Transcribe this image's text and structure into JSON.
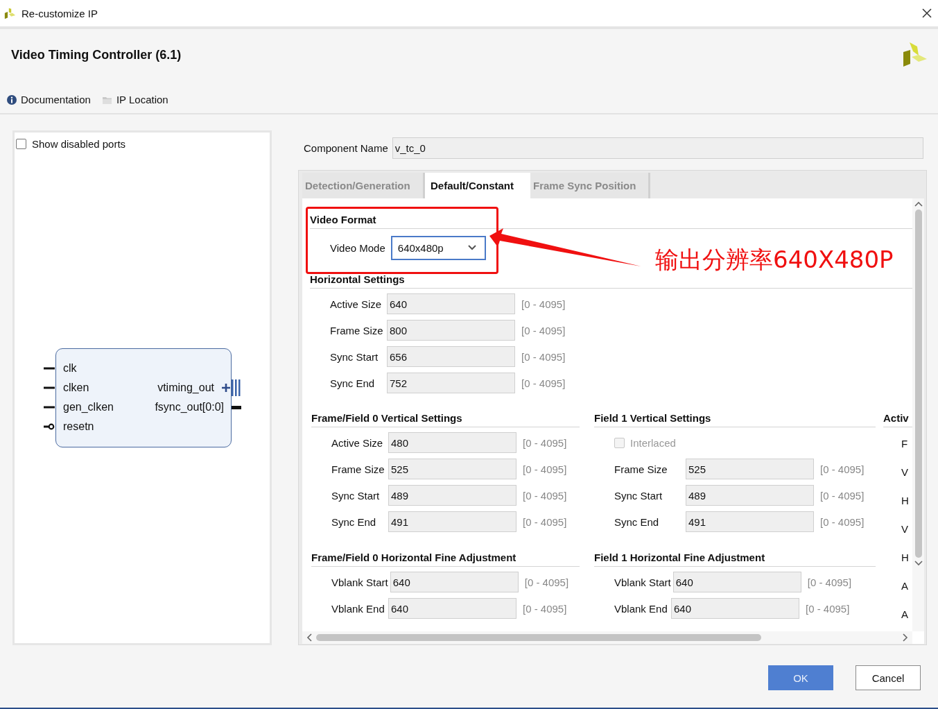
{
  "window": {
    "title": "Re-customize IP"
  },
  "header": {
    "title": "Video Timing Controller (6.1)",
    "links": [
      {
        "kind": "info",
        "label": "Documentation"
      },
      {
        "kind": "folder",
        "label": "IP Location"
      }
    ]
  },
  "symbol_panel": {
    "show_disabled_ports": {
      "label": "Show disabled ports",
      "checked": false
    },
    "inputs": [
      {
        "kind": "plain",
        "name": "clk"
      },
      {
        "kind": "plain",
        "name": "clken"
      },
      {
        "kind": "plain",
        "name": "gen_clken"
      },
      {
        "kind": "inverted",
        "name": "resetn"
      }
    ],
    "outputs": [
      {
        "kind": "interface",
        "name": "vtiming_out"
      },
      {
        "kind": "bus",
        "name": "fsync_out[0:0]"
      }
    ]
  },
  "component_name": {
    "label": "Component Name",
    "value": "v_tc_0"
  },
  "tabs": [
    {
      "label": "Detection/Generation",
      "selected": false
    },
    {
      "label": "Default/Constant",
      "selected": true
    },
    {
      "label": "Frame Sync Position",
      "selected": false
    }
  ],
  "video_format": {
    "title": "Video Format",
    "label": "Video Mode",
    "value": "640x480p"
  },
  "horizontal_settings": {
    "title": "Horizontal Settings",
    "rows": [
      {
        "kind": "field",
        "label": "Active Size",
        "value": "640",
        "range": "[0 - 4095]"
      },
      {
        "kind": "field",
        "label": "Frame Size",
        "value": "800",
        "range": "[0 - 4095]"
      },
      {
        "kind": "field",
        "label": "Sync Start",
        "value": "656",
        "range": "[0 - 4095]"
      },
      {
        "kind": "field",
        "label": "Sync End",
        "value": "752",
        "range": "[0 - 4095]"
      }
    ]
  },
  "columns": [
    {
      "sections": [
        {
          "title": "Frame/Field 0 Vertical Settings",
          "rows": [
            {
              "kind": "field",
              "label": "Active Size",
              "value": "480",
              "range": "[0 - 4095]"
            },
            {
              "kind": "field",
              "label": "Frame Size",
              "value": "525",
              "range": "[0 - 4095]"
            },
            {
              "kind": "field",
              "label": "Sync Start",
              "value": "489",
              "range": "[0 - 4095]"
            },
            {
              "kind": "field",
              "label": "Sync End",
              "value": "491",
              "range": "[0 - 4095]"
            }
          ]
        },
        {
          "title": "Frame/Field 0 Horizontal Fine Adjustment",
          "rows": [
            {
              "kind": "field",
              "label": "Vblank Start",
              "value": "640",
              "range": "[0 - 4095]"
            },
            {
              "kind": "field",
              "label": "Vblank End",
              "value": "640",
              "range": "[0 - 4095]"
            }
          ]
        }
      ]
    },
    {
      "sections": [
        {
          "title": "Field 1 Vertical Settings",
          "rows": [
            {
              "kind": "checkbox",
              "label": "Interlaced",
              "checked": false,
              "disabled": true
            },
            {
              "kind": "field",
              "label": "Frame Size",
              "value": "525",
              "range": "[0 - 4095]"
            },
            {
              "kind": "field",
              "label": "Sync Start",
              "value": "489",
              "range": "[0 - 4095]"
            },
            {
              "kind": "field",
              "label": "Sync End",
              "value": "491",
              "range": "[0 - 4095]"
            }
          ]
        },
        {
          "title": "Field 1 Horizontal Fine Adjustment",
          "rows": [
            {
              "kind": "field",
              "label": "Vblank Start",
              "value": "640",
              "range": "[0 - 4095]"
            },
            {
              "kind": "field",
              "label": "Vblank End",
              "value": "640",
              "range": "[0 - 4095]"
            }
          ]
        }
      ]
    },
    {
      "sections": [
        {
          "title": "Activ",
          "rows": [
            {
              "kind": "label",
              "label": "F"
            },
            {
              "kind": "label",
              "label": "V"
            },
            {
              "kind": "label",
              "label": "H"
            },
            {
              "kind": "label",
              "label": "V"
            },
            {
              "kind": "label",
              "label": "H"
            },
            {
              "kind": "label",
              "label": "A"
            },
            {
              "kind": "label",
              "label": "A"
            }
          ]
        }
      ]
    }
  ],
  "annotation": {
    "text": "输出分辨率640X480P"
  },
  "buttons": [
    {
      "kind": "primary",
      "label": "OK"
    },
    {
      "kind": "secondary",
      "label": "Cancel"
    }
  ]
}
